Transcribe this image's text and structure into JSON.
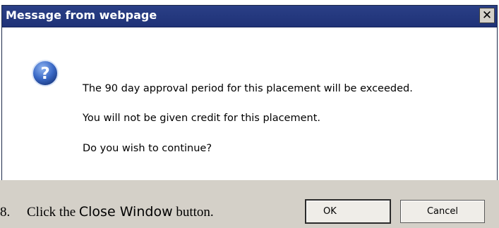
{
  "dialog": {
    "title": "Message from webpage",
    "close_glyph": "✕",
    "icon": "question-icon",
    "messages": [
      "The 90 day approval period for this placement will be exceeded.",
      "You will not be given credit for this placement.",
      "Do you wish to continue?"
    ],
    "ok_label": "OK",
    "cancel_label": "Cancel"
  },
  "document": {
    "step_number": "8.",
    "text_before": "Click the ",
    "emphasis": "Close Window",
    "text_after": " button."
  },
  "colors": {
    "titlebar": "#1f3277",
    "footer": "#d4d0c8",
    "icon_blue": "#3a69c6"
  }
}
